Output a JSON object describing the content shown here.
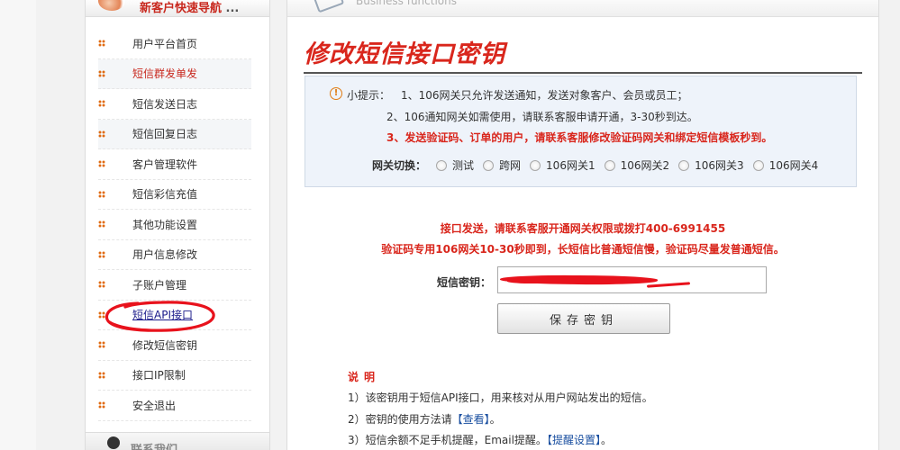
{
  "sidebar": {
    "header_title": "新客户快速导航",
    "header_suffix": " ...",
    "items": [
      {
        "label": "用户平台首页"
      },
      {
        "label": "短信群发单发"
      },
      {
        "label": "短信发送日志"
      },
      {
        "label": "短信回复日志"
      },
      {
        "label": "客户管理软件"
      },
      {
        "label": "短信彩信充值"
      },
      {
        "label": "其他功能设置"
      },
      {
        "label": "用户信息修改"
      },
      {
        "label": "子账户管理"
      },
      {
        "label": "短信API接口"
      },
      {
        "label": "修改短信密钥"
      },
      {
        "label": "接口IP限制"
      },
      {
        "label": "安全退出"
      }
    ],
    "footer_title": "联系我们"
  },
  "main": {
    "header_sub": "Business functions",
    "page_title": "修改短信接口密钥",
    "tips": {
      "prefix": "小提示：",
      "line1": "1、106网关只允许发送通知，发送对象客户、会员或员工；",
      "line2": "2、106通知网关如需使用，请联系客服申请开通，3-30秒到达。",
      "line3": "3、发送验证码、订单的用户，请联系客服修改验证码网关和绑定短信模板秒到。"
    },
    "gateway": {
      "label": "网关切换：",
      "options": [
        "测试",
        "跨网",
        "106网关1",
        "106网关2",
        "106网关3",
        "106网关4"
      ]
    },
    "notice1": "接口发送，请联系客服开通网关权限或拨打400-6991455",
    "notice2": "验证码专用106网关10-30秒即到，长短信比普通短信慢，验证码尽量发普通短信。",
    "key_label": "短信密钥：",
    "save_label": "保存密钥",
    "explain": {
      "title": "说明",
      "line1": "1）该密钥用于短信API接口，用来核对从用户网站发出的短信。",
      "line2_prefix": "2）密钥的使用方法请",
      "line2_link": "【查看】",
      "line2_suffix": "。",
      "line3_prefix": "3）短信余额不足手机提醒，Email提醒。",
      "line3_link": "【提醒设置】",
      "line3_suffix": "。"
    }
  },
  "colors": {
    "accent_red": "#d9261c",
    "bullet_orange": "#e06a10",
    "link_blue": "#1a4fa0",
    "annotation_red": "#e8121c"
  }
}
